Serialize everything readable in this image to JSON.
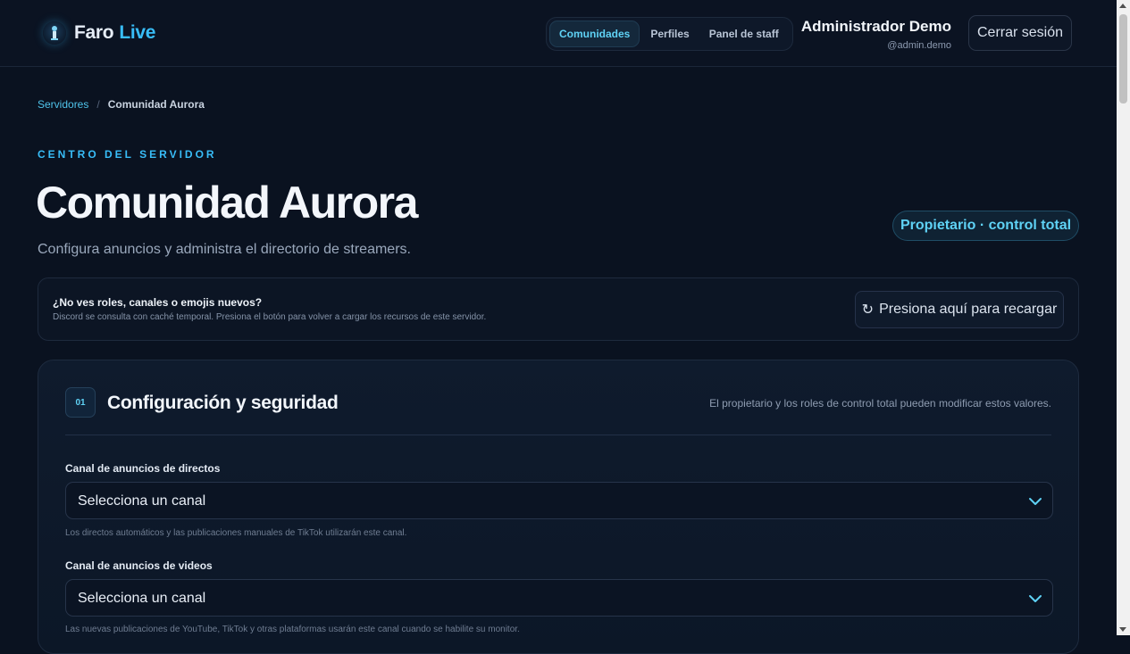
{
  "brand": {
    "name": "Faro",
    "accent_word": "Live",
    "accent_color": "#38bdf8",
    "logo_icon": "lighthouse-icon"
  },
  "nav": {
    "items": [
      {
        "label": "Comunidades",
        "active": true
      },
      {
        "label": "Perfiles",
        "active": false
      },
      {
        "label": "Panel de staff",
        "active": false
      }
    ]
  },
  "user": {
    "name": "Administrador Demo",
    "handle": "@admin.demo"
  },
  "logout_label": "Cerrar sesión",
  "breadcrumb": {
    "root": "Servidores",
    "separator": "/",
    "current": "Comunidad Aurora"
  },
  "page": {
    "eyebrow": "CENTRO DEL SERVIDOR",
    "title": "Comunidad Aurora",
    "subtitle": "Configura anuncios y administra el directorio de streamers.",
    "role_badge": "Propietario · control total"
  },
  "notice": {
    "title": "¿No ves roles, canales o emojis nuevos?",
    "description": "Discord se consulta con caché temporal. Presiona el botón para volver a cargar los recursos de este servidor.",
    "button_label": "Presiona aquí para recargar",
    "button_icon": "reload-icon"
  },
  "section": {
    "number": "01",
    "title": "Configuración y seguridad",
    "note": "El propietario y los roles de control total pueden modificar estos valores.",
    "fields": [
      {
        "label": "Canal de anuncios de directos",
        "value": "Selecciona un canal",
        "help": "Los directos automáticos y las publicaciones manuales de TikTok utilizarán este canal."
      },
      {
        "label": "Canal de anuncios de videos",
        "value": "Selecciona un canal",
        "help": "Las nuevas publicaciones de YouTube, TikTok y otras plataformas usarán este canal cuando se habilite su monitor."
      }
    ]
  }
}
